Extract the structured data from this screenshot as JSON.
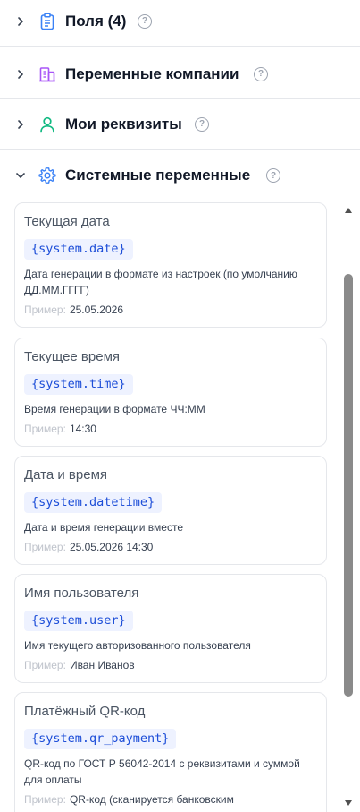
{
  "sections": [
    {
      "title": "Поля (4)",
      "icon": "clipboard-icon",
      "expanded": false
    },
    {
      "title": "Переменные компании",
      "icon": "building-icon",
      "expanded": false
    },
    {
      "title": "Мои реквизиты",
      "icon": "user-icon",
      "expanded": false
    },
    {
      "title": "Системные переменные",
      "icon": "gear-icon",
      "expanded": true
    }
  ],
  "help_glyph": "?",
  "example_label": "Пример:",
  "variables": [
    {
      "title": "Текущая дата",
      "code": "{system.date}",
      "description": "Дата генерации в формате из настроек (по умолчанию ДД.ММ.ГГГГ)",
      "example": "25.05.2026"
    },
    {
      "title": "Текущее время",
      "code": "{system.time}",
      "description": "Время генерации в формате ЧЧ:ММ",
      "example": "14:30"
    },
    {
      "title": "Дата и время",
      "code": "{system.datetime}",
      "description": "Дата и время генерации вместе",
      "example": "25.05.2026 14:30"
    },
    {
      "title": "Имя пользователя",
      "code": "{system.user}",
      "description": "Имя текущего авторизованного пользователя",
      "example": "Иван Иванов"
    },
    {
      "title": "Платёжный QR-код",
      "code": "{system.qr_payment}",
      "description": "QR-код по ГОСТ Р 56042-2014 с реквизитами и суммой для оплаты",
      "example": "QR-код (сканируется банковским"
    }
  ],
  "colors": {
    "accent_code": "#1d4ed8",
    "chip_bg": "#eef2ff",
    "clipboard_icon": "#3b82f6",
    "building_icon": "#a855f7",
    "user_icon": "#10b981",
    "gear_icon": "#3b82f6",
    "border": "#e5e7eb"
  }
}
